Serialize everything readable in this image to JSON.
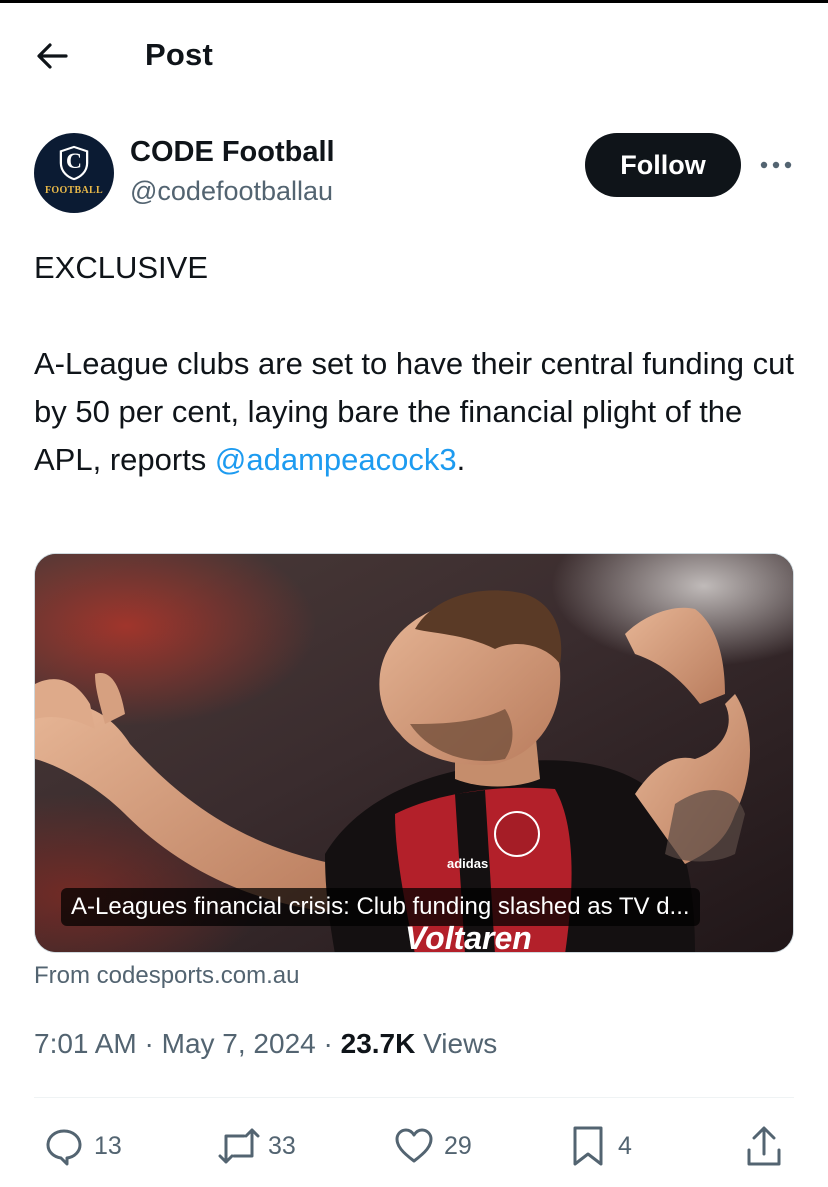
{
  "header": {
    "title": "Post"
  },
  "author": {
    "name": "CODE Football",
    "handle": "@codefootballau",
    "avatar_text": "FOOTBALL",
    "avatar_letter": "C",
    "follow_label": "Follow"
  },
  "post": {
    "line1": "EXCLUSIVE",
    "line2_text": "A-League clubs are set to have their central funding cut by 50 per cent, laying bare the financial plight of the APL, reports ",
    "mention": "@adampeacock3",
    "line2_end": "."
  },
  "card": {
    "caption": "A-Leagues financial crisis: Club funding slashed as TV d...",
    "source": "From codesports.com.au",
    "jersey_text": "Voltaren",
    "jersey_brand": "adidas"
  },
  "meta": {
    "time": "7:01 AM",
    "separator": "·",
    "date": "May 7, 2024",
    "views_count": "23.7K",
    "views_label": "Views"
  },
  "actions": {
    "replies": "13",
    "reposts": "33",
    "likes": "29",
    "bookmarks": "4"
  },
  "colors": {
    "accent": "#1d9bf0",
    "text": "#0f1419",
    "muted": "#536471",
    "button_bg": "#0f1419"
  }
}
